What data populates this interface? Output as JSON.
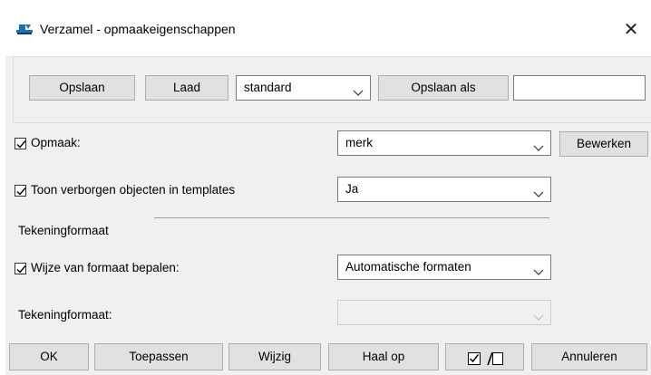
{
  "window": {
    "title": "Verzamel - opmaakeigenschappen",
    "close_icon": "close-icon"
  },
  "toolbar": {
    "save_label": "Opslaan",
    "load_label": "Laad",
    "preset_value": "standard",
    "save_as_label": "Opslaan als",
    "save_as_name": ""
  },
  "rows": {
    "opmaak": {
      "label": "Opmaak:",
      "checked": true,
      "value": "merk",
      "edit_label": "Bewerken"
    },
    "toon": {
      "label": "Toon verborgen objecten in templates",
      "checked": true,
      "value": "Ja"
    },
    "section_label": "Tekeningformaat",
    "wijze": {
      "label": "Wijze van formaat bepalen:",
      "checked": true,
      "value": "Automatische formaten"
    },
    "formaat": {
      "label": "Tekeningformaat:",
      "value": "",
      "disabled": true
    }
  },
  "footer": {
    "ok_label": "OK",
    "apply_label": "Toepassen",
    "modify_label": "Wijzig",
    "get_label": "Haal op",
    "toggle_icon": "check-toggle-icon",
    "cancel_label": "Annuleren"
  }
}
